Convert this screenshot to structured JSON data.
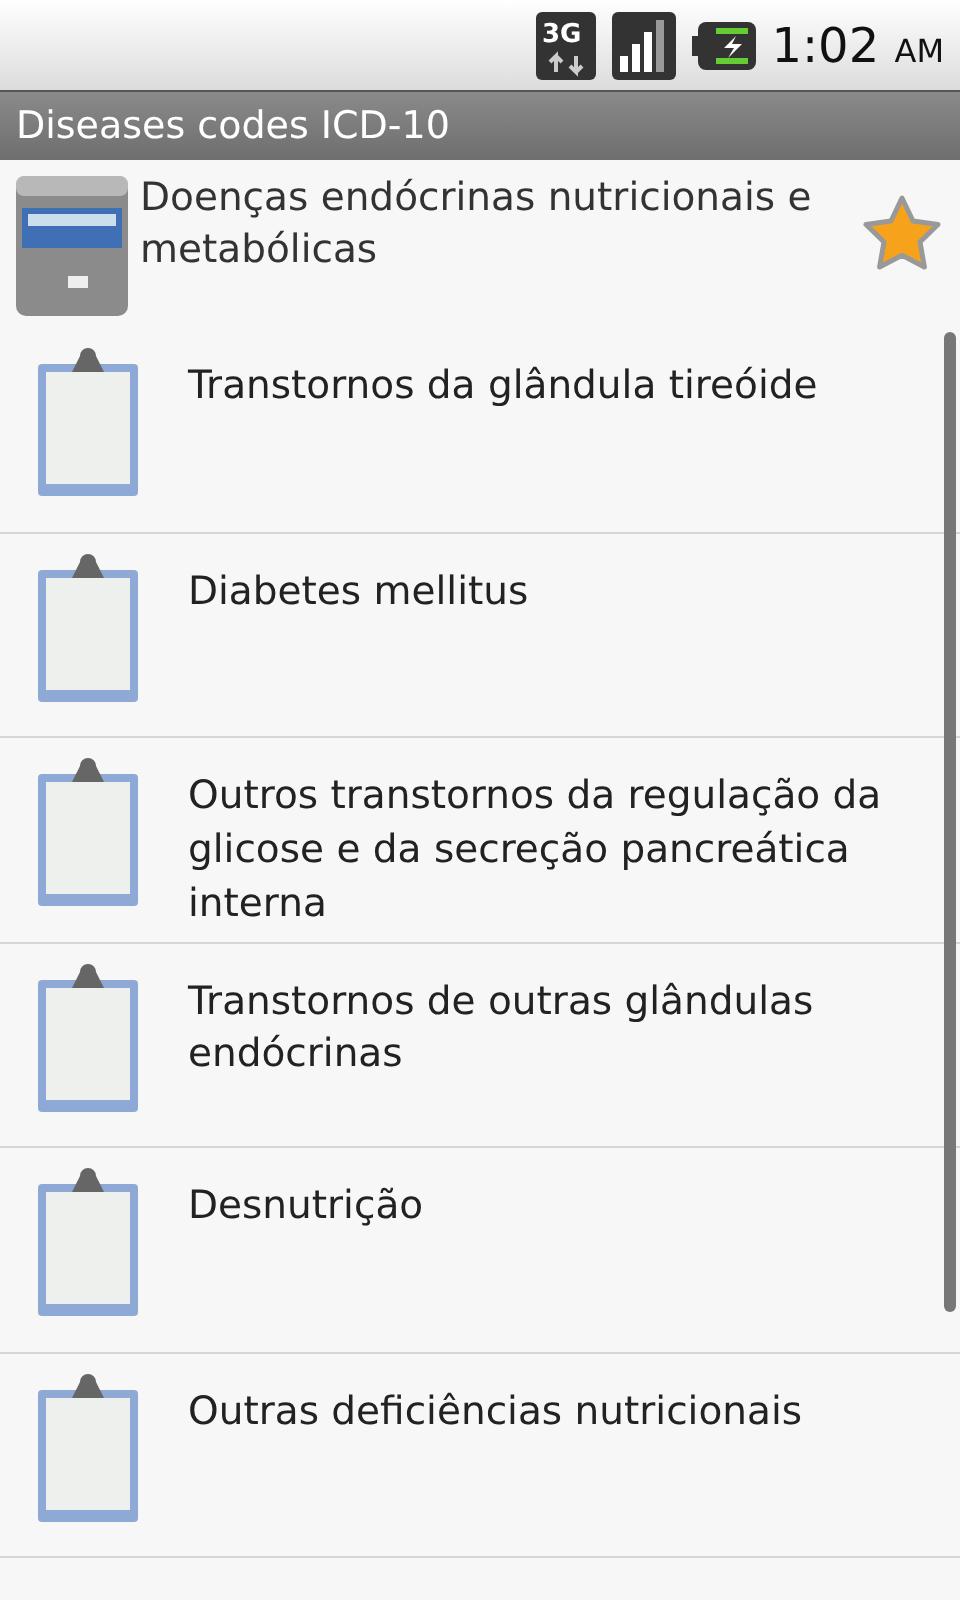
{
  "status_bar": {
    "network": "3G",
    "time": "1:02",
    "ampm": "AM"
  },
  "app_title": "Diseases codes ICD-10",
  "header": {
    "title": "Doenças endócrinas nutricionais e metabólicas",
    "starred": true
  },
  "items": [
    {
      "label": "Transtornos da glândula tireóide"
    },
    {
      "label": "Diabetes mellitus"
    },
    {
      "label": "Outros transtornos da regulação da glicose e da secreção pancreática interna"
    },
    {
      "label": "Transtornos de outras glândulas endócrinas"
    },
    {
      "label": "Desnutrição"
    },
    {
      "label": "Outras deficiências nutricionais"
    }
  ]
}
